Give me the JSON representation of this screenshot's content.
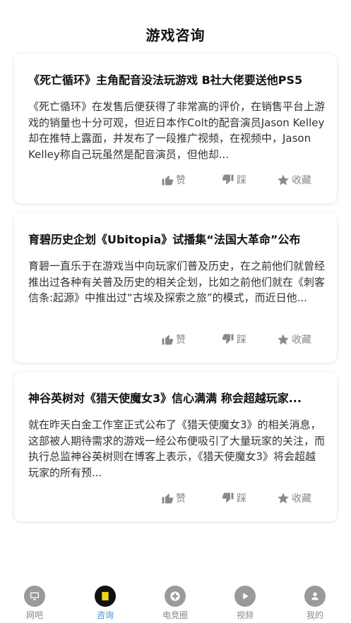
{
  "header": {
    "title": "游戏咨询"
  },
  "actions": {
    "like": "赞",
    "dislike": "踩",
    "favorite": "收藏"
  },
  "articles": [
    {
      "title": "《死亡循环》主角配音没法玩游戏 B社大佬要送他PS5",
      "summary": "《死亡循环》在发售后便获得了非常高的评价，在销售平台上游戏的销量也十分可观，但近日本作Colt的配音演员Jason Kelley却在推特上露面，并发布了一段推广视频，在视频中，Jason Kelley称自己玩虽然是配音演员，但他却..."
    },
    {
      "title": "育碧历史企划《Ubitopia》试播集“法国大革命”公布",
      "summary": "育碧一直乐于在游戏当中向玩家们普及历史，在之前他们就曾经推出过各种有关普及历史的相关企划，比如之前他们就在《刺客信条:起源》中推出过“古埃及探索之旅”的模式，而近日他..."
    },
    {
      "title": "神谷英树对《猎天使魔女3》信心满满 称会超越玩家...",
      "summary": "就在昨天白金工作室正式公布了《猎天使魔女3》的相关消息，这部被人期待需求的游戏一经公布便吸引了大量玩家的关注，而执行总监神谷英树则在博客上表示，《猎天使魔女3》将会超越玩家的所有预..."
    }
  ],
  "tabbar": {
    "items": [
      {
        "label": "网吧",
        "icon": "monitor-icon"
      },
      {
        "label": "咨询",
        "icon": "document-icon",
        "active": true
      },
      {
        "label": "电竞圈",
        "icon": "aperture-icon"
      },
      {
        "label": "视频",
        "icon": "play-icon"
      },
      {
        "label": "我的",
        "icon": "user-icon"
      }
    ],
    "active_color": "#4a8bd6"
  }
}
